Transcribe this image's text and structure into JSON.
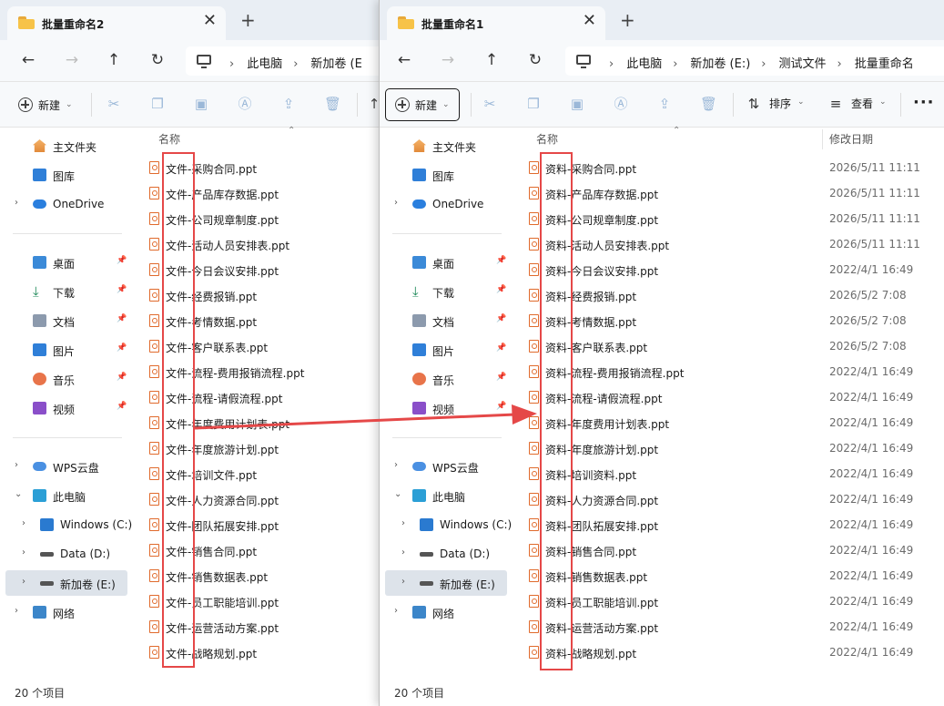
{
  "colors": {
    "accent_red": "#e54848",
    "ppt_orange": "#e06a2c",
    "folder_yellow": "#f7c348"
  },
  "window_left": {
    "tab_title": "批量重命名2",
    "breadcrumbs": [
      "此电脑",
      "新加卷 (E"
    ],
    "new_label": "新建",
    "column_name": "名称",
    "files": [
      "文件-采购合同.ppt",
      "文件-产品库存数据.ppt",
      "文件-公司规章制度.ppt",
      "文件-活动人员安排表.ppt",
      "文件-今日会议安排.ppt",
      "文件-经费报销.ppt",
      "文件-考情数据.ppt",
      "文件-客户联系表.ppt",
      "文件-流程-费用报销流程.ppt",
      "文件-流程-请假流程.ppt",
      "文件-年度费用计划表.ppt",
      "文件-年度旅游计划.ppt",
      "文件-培训文件.ppt",
      "文件-人力资源合同.ppt",
      "文件-团队拓展安排.ppt",
      "文件-销售合同.ppt",
      "文件-销售数据表.ppt",
      "文件-员工职能培训.ppt",
      "文件-运营活动方案.ppt",
      "文件-战略规划.ppt"
    ],
    "status": "20 个项目"
  },
  "window_right": {
    "tab_title": "批量重命名1",
    "breadcrumbs": [
      "此电脑",
      "新加卷 (E:)",
      "测试文件",
      "批量重命名"
    ],
    "new_label": "新建",
    "sort_label": "排序",
    "view_label": "查看",
    "column_name": "名称",
    "column_date": "修改日期",
    "files": [
      {
        "name": "资料-采购合同.ppt",
        "date": "2026/5/11 11:11"
      },
      {
        "name": "资料-产品库存数据.ppt",
        "date": "2026/5/11 11:11"
      },
      {
        "name": "资料-公司规章制度.ppt",
        "date": "2026/5/11 11:11"
      },
      {
        "name": "资料-活动人员安排表.ppt",
        "date": "2026/5/11 11:11"
      },
      {
        "name": "资料-今日会议安排.ppt",
        "date": "2022/4/1 16:49"
      },
      {
        "name": "资料-经费报销.ppt",
        "date": "2026/5/2 7:08"
      },
      {
        "name": "资料-考情数据.ppt",
        "date": "2026/5/2 7:08"
      },
      {
        "name": "资料-客户联系表.ppt",
        "date": "2026/5/2 7:08"
      },
      {
        "name": "资料-流程-费用报销流程.ppt",
        "date": "2022/4/1 16:49"
      },
      {
        "name": "资料-流程-请假流程.ppt",
        "date": "2022/4/1 16:49"
      },
      {
        "name": "资料-年度费用计划表.ppt",
        "date": "2022/4/1 16:49"
      },
      {
        "name": "资料-年度旅游计划.ppt",
        "date": "2022/4/1 16:49"
      },
      {
        "name": "资料-培训资料.ppt",
        "date": "2022/4/1 16:49"
      },
      {
        "name": "资料-人力资源合同.ppt",
        "date": "2022/4/1 16:49"
      },
      {
        "name": "资料-团队拓展安排.ppt",
        "date": "2022/4/1 16:49"
      },
      {
        "name": "资料-销售合同.ppt",
        "date": "2022/4/1 16:49"
      },
      {
        "name": "资料-销售数据表.ppt",
        "date": "2022/4/1 16:49"
      },
      {
        "name": "资料-员工职能培训.ppt",
        "date": "2022/4/1 16:49"
      },
      {
        "name": "资料-运营活动方案.ppt",
        "date": "2022/4/1 16:49"
      },
      {
        "name": "资料-战略规划.ppt",
        "date": "2022/4/1 16:49"
      }
    ],
    "status": "20 个项目"
  },
  "sidebar": {
    "quick": [
      {
        "label": "主文件夹",
        "icon": "home-icon"
      },
      {
        "label": "图库",
        "icon": "gallery-icon"
      },
      {
        "label": "OneDrive",
        "icon": "cloud-icon"
      }
    ],
    "pinned": [
      {
        "label": "桌面",
        "icon": "desktop-icon"
      },
      {
        "label": "下载",
        "icon": "download-icon"
      },
      {
        "label": "文档",
        "icon": "document-icon"
      },
      {
        "label": "图片",
        "icon": "picture-icon"
      },
      {
        "label": "音乐",
        "icon": "music-icon"
      },
      {
        "label": "视频",
        "icon": "video-icon"
      }
    ],
    "tree": [
      {
        "label": "WPS云盘",
        "icon": "wps-cloud-icon"
      },
      {
        "label": "此电脑",
        "icon": "pc-icon"
      },
      {
        "label": "Windows (C:)",
        "icon": "windows-drive-icon"
      },
      {
        "label": "Data (D:)",
        "icon": "drive-icon"
      },
      {
        "label": "新加卷 (E:)",
        "icon": "drive-icon"
      },
      {
        "label": "网络",
        "icon": "network-icon"
      }
    ]
  }
}
